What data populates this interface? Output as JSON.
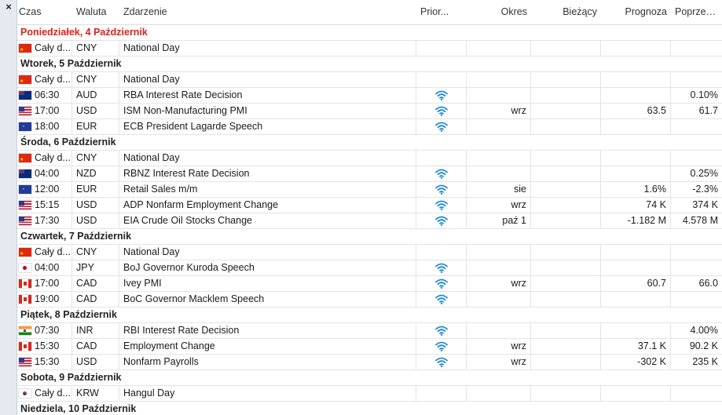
{
  "sidebar": {
    "close_glyph": "×"
  },
  "columns": {
    "time": "Czas",
    "currency": "Waluta",
    "event": "Zdarzenie",
    "priority": "Prior...",
    "period": "Okres",
    "actual": "Bieżący",
    "forecast": "Prognoza",
    "previous": "Poprzedni"
  },
  "priority_icon": "signal-icon",
  "colors": {
    "today": "#e0201b",
    "priority": "#1a86d8"
  },
  "days": [
    {
      "date": "Poniedziałek, 4 Październik",
      "today": true,
      "events": [
        {
          "flag": "cn",
          "time": "Cały d...",
          "currency": "CNY",
          "event": "National Day",
          "priority": false,
          "period": "",
          "actual": "",
          "forecast": "",
          "previous": ""
        }
      ]
    },
    {
      "date": "Wtorek, 5 Październik",
      "today": false,
      "events": [
        {
          "flag": "cn",
          "time": "Cały d...",
          "currency": "CNY",
          "event": "National Day",
          "priority": false,
          "period": "",
          "actual": "",
          "forecast": "",
          "previous": ""
        },
        {
          "flag": "au",
          "time": "06:30",
          "currency": "AUD",
          "event": "RBA Interest Rate Decision",
          "priority": true,
          "period": "",
          "actual": "",
          "forecast": "",
          "previous": "0.10%"
        },
        {
          "flag": "us",
          "time": "17:00",
          "currency": "USD",
          "event": "ISM Non-Manufacturing PMI",
          "priority": true,
          "period": "wrz",
          "actual": "",
          "forecast": "63.5",
          "previous": "61.7"
        },
        {
          "flag": "eu",
          "time": "18:00",
          "currency": "EUR",
          "event": "ECB President Lagarde Speech",
          "priority": true,
          "period": "",
          "actual": "",
          "forecast": "",
          "previous": ""
        }
      ]
    },
    {
      "date": "Środa, 6 Październik",
      "today": false,
      "events": [
        {
          "flag": "cn",
          "time": "Cały d...",
          "currency": "CNY",
          "event": "National Day",
          "priority": false,
          "period": "",
          "actual": "",
          "forecast": "",
          "previous": ""
        },
        {
          "flag": "nz",
          "time": "04:00",
          "currency": "NZD",
          "event": "RBNZ Interest Rate Decision",
          "priority": true,
          "period": "",
          "actual": "",
          "forecast": "",
          "previous": "0.25%"
        },
        {
          "flag": "eu",
          "time": "12:00",
          "currency": "EUR",
          "event": "Retail Sales m/m",
          "priority": true,
          "period": "sie",
          "actual": "",
          "forecast": "1.6%",
          "previous": "-2.3%"
        },
        {
          "flag": "us",
          "time": "15:15",
          "currency": "USD",
          "event": "ADP Nonfarm Employment Change",
          "priority": true,
          "period": "wrz",
          "actual": "",
          "forecast": "74 K",
          "previous": "374 K"
        },
        {
          "flag": "us",
          "time": "17:30",
          "currency": "USD",
          "event": "EIA Crude Oil Stocks Change",
          "priority": true,
          "period": "paź 1",
          "actual": "",
          "forecast": "-1.182 M",
          "previous": "4.578 M"
        }
      ]
    },
    {
      "date": "Czwartek, 7 Październik",
      "today": false,
      "events": [
        {
          "flag": "cn",
          "time": "Cały d...",
          "currency": "CNY",
          "event": "National Day",
          "priority": false,
          "period": "",
          "actual": "",
          "forecast": "",
          "previous": ""
        },
        {
          "flag": "jp",
          "time": "04:00",
          "currency": "JPY",
          "event": "BoJ Governor Kuroda Speech",
          "priority": true,
          "period": "",
          "actual": "",
          "forecast": "",
          "previous": ""
        },
        {
          "flag": "ca",
          "time": "17:00",
          "currency": "CAD",
          "event": "Ivey PMI",
          "priority": true,
          "period": "wrz",
          "actual": "",
          "forecast": "60.7",
          "previous": "66.0"
        },
        {
          "flag": "ca",
          "time": "19:00",
          "currency": "CAD",
          "event": "BoC Governor Macklem Speech",
          "priority": true,
          "period": "",
          "actual": "",
          "forecast": "",
          "previous": ""
        }
      ]
    },
    {
      "date": "Piątek, 8 Październik",
      "today": false,
      "events": [
        {
          "flag": "in",
          "time": "07:30",
          "currency": "INR",
          "event": "RBI Interest Rate Decision",
          "priority": true,
          "period": "",
          "actual": "",
          "forecast": "",
          "previous": "4.00%"
        },
        {
          "flag": "ca",
          "time": "15:30",
          "currency": "CAD",
          "event": "Employment Change",
          "priority": true,
          "period": "wrz",
          "actual": "",
          "forecast": "37.1 K",
          "previous": "90.2 K"
        },
        {
          "flag": "us",
          "time": "15:30",
          "currency": "USD",
          "event": "Nonfarm Payrolls",
          "priority": true,
          "period": "wrz",
          "actual": "",
          "forecast": "-302 K",
          "previous": "235 K"
        }
      ]
    },
    {
      "date": "Sobota, 9 Październik",
      "today": false,
      "events": [
        {
          "flag": "kr",
          "time": "Cały d...",
          "currency": "KRW",
          "event": "Hangul Day",
          "priority": false,
          "period": "",
          "actual": "",
          "forecast": "",
          "previous": ""
        }
      ]
    },
    {
      "date": "Niedziela, 10 Październik",
      "today": false,
      "events": []
    }
  ]
}
